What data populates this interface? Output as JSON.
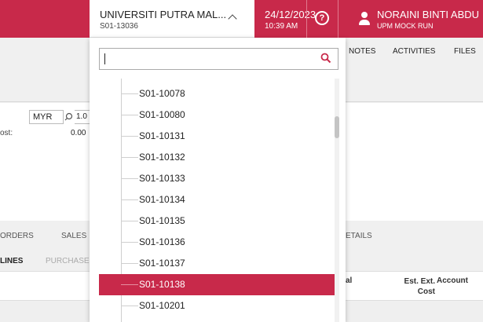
{
  "header": {
    "branch_name": "UNIVERSITI PUTRA MAL...",
    "branch_code": "S01-13036",
    "date": "24/12/2023",
    "time": "10:39 AM",
    "user_name": "NORAINI BINTI ABDU",
    "user_sub": "UPM MOCK RUN",
    "accent_color": "#c8294a"
  },
  "toolbar": {
    "tabs": [
      "NOTES",
      "ACTIVITIES",
      "FILES"
    ]
  },
  "form": {
    "currency": "MYR",
    "rate": "1.0",
    "cost_label": "ost:",
    "cost_value": "0.00"
  },
  "lower_tabs": {
    "row1": [
      "ORDERS",
      "SALES",
      "ETAILS"
    ],
    "row2": [
      "LINES",
      "PURCHASE"
    ]
  },
  "grid": {
    "columns": [
      "al",
      "Est. Ext. Cost",
      "Account"
    ]
  },
  "dropdown": {
    "search_value": "",
    "items": [
      "S01-10078",
      "S01-10080",
      "S01-10131",
      "S01-10132",
      "S01-10133",
      "S01-10134",
      "S01-10135",
      "S01-10136",
      "S01-10137",
      "S01-10138",
      "S01-10201"
    ],
    "selected": "S01-10138"
  }
}
